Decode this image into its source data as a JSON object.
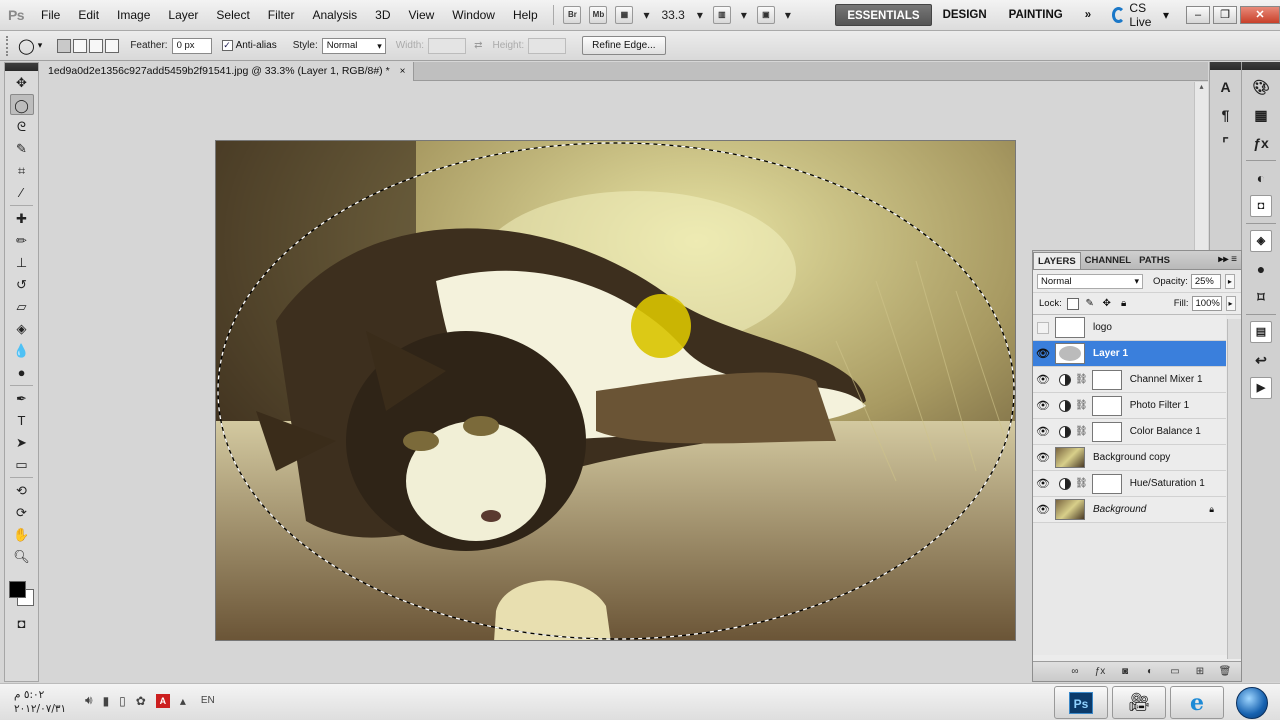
{
  "app": {
    "logo": "Ps"
  },
  "menu": [
    "File",
    "Edit",
    "Image",
    "Layer",
    "Select",
    "Filter",
    "Analysis",
    "3D",
    "View",
    "Window",
    "Help"
  ],
  "menubar": {
    "bridge_label": "Br",
    "minibridge_label": "Mb",
    "zoom_value": "33.3",
    "workspaces": [
      "ESSENTIALS",
      "DESIGN",
      "PAINTING"
    ],
    "more_label": "»",
    "cs_live": "CS Live"
  },
  "options": {
    "feather_label": "Feather:",
    "feather_value": "0 px",
    "antialias_label": "Anti-alias",
    "style_label": "Style:",
    "style_value": "Normal",
    "width_label": "Width:",
    "height_label": "Height:",
    "refine_edge": "Refine Edge..."
  },
  "document": {
    "tab_title": "1ed9a0d2e1356c927add5459b2f91541.jpg @ 33.3% (Layer 1, RGB/8#) *",
    "close": "×"
  },
  "layers_panel": {
    "tabs": [
      "LAYERS",
      "CHANNEL",
      "PATHS"
    ],
    "blend_mode": "Normal",
    "opacity_label": "Opacity:",
    "opacity_value": "25%",
    "lock_label": "Lock:",
    "fill_label": "Fill:",
    "fill_value": "100%",
    "layers": [
      {
        "name": "logo",
        "visible": false,
        "thumb": "logo",
        "adjustment": false,
        "selected": false
      },
      {
        "name": "Layer 1",
        "visible": true,
        "thumb": "oval",
        "adjustment": false,
        "selected": true
      },
      {
        "name": "Channel Mixer 1",
        "visible": true,
        "thumb": "mask",
        "adjustment": true,
        "selected": false
      },
      {
        "name": "Photo Filter 1",
        "visible": true,
        "thumb": "mask",
        "adjustment": true,
        "selected": false
      },
      {
        "name": "Color Balance 1",
        "visible": true,
        "thumb": "mask",
        "adjustment": true,
        "selected": false
      },
      {
        "name": "Background copy",
        "visible": true,
        "thumb": "photo",
        "adjustment": false,
        "selected": false
      },
      {
        "name": "Hue/Saturation 1",
        "visible": true,
        "thumb": "mask",
        "adjustment": true,
        "selected": false
      },
      {
        "name": "Background",
        "visible": true,
        "thumb": "photo",
        "adjustment": false,
        "selected": false,
        "italic": true,
        "locked": true
      }
    ]
  },
  "taskbar": {
    "time": "٥:٠٢ م",
    "date": "٢٠١٢/٠٧/٣١",
    "language": "EN"
  },
  "colors": {
    "selection_blue": "#3a7fdc",
    "workspace_active": "#666666"
  }
}
